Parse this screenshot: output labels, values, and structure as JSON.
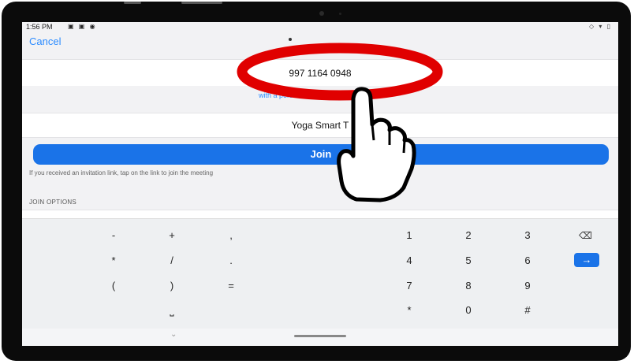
{
  "status_bar": {
    "time": "1:56 PM",
    "left_icons": "▣ ▣ ◉",
    "right_icons": "◇ ▾ ▯"
  },
  "header": {
    "cancel_label": "Cancel"
  },
  "meeting": {
    "id_value": "997 1164 0948",
    "personal_link_partial": "with a personal link name",
    "name_value": "Yoga Smart T"
  },
  "join_label": "Join",
  "hint_text": "If you received an invitation link, tap on the link to join the meeting",
  "join_options_heading": "JOIN OPTIONS",
  "keyboard": {
    "row1": [
      "-",
      "+",
      ",",
      "1",
      "2",
      "3"
    ],
    "row2": [
      "*",
      "/",
      ".",
      "4",
      "5",
      "6"
    ],
    "row3": [
      "(",
      ")",
      "=",
      "7",
      "8",
      "9"
    ],
    "row4": [
      "⎵",
      "*",
      "0",
      "#"
    ],
    "backspace": "⌫",
    "go": "→"
  },
  "nav_bar": {
    "back_chevron": "⌄"
  },
  "colors": {
    "accent": "#1a73e8",
    "annotation_red": "#e00000"
  }
}
